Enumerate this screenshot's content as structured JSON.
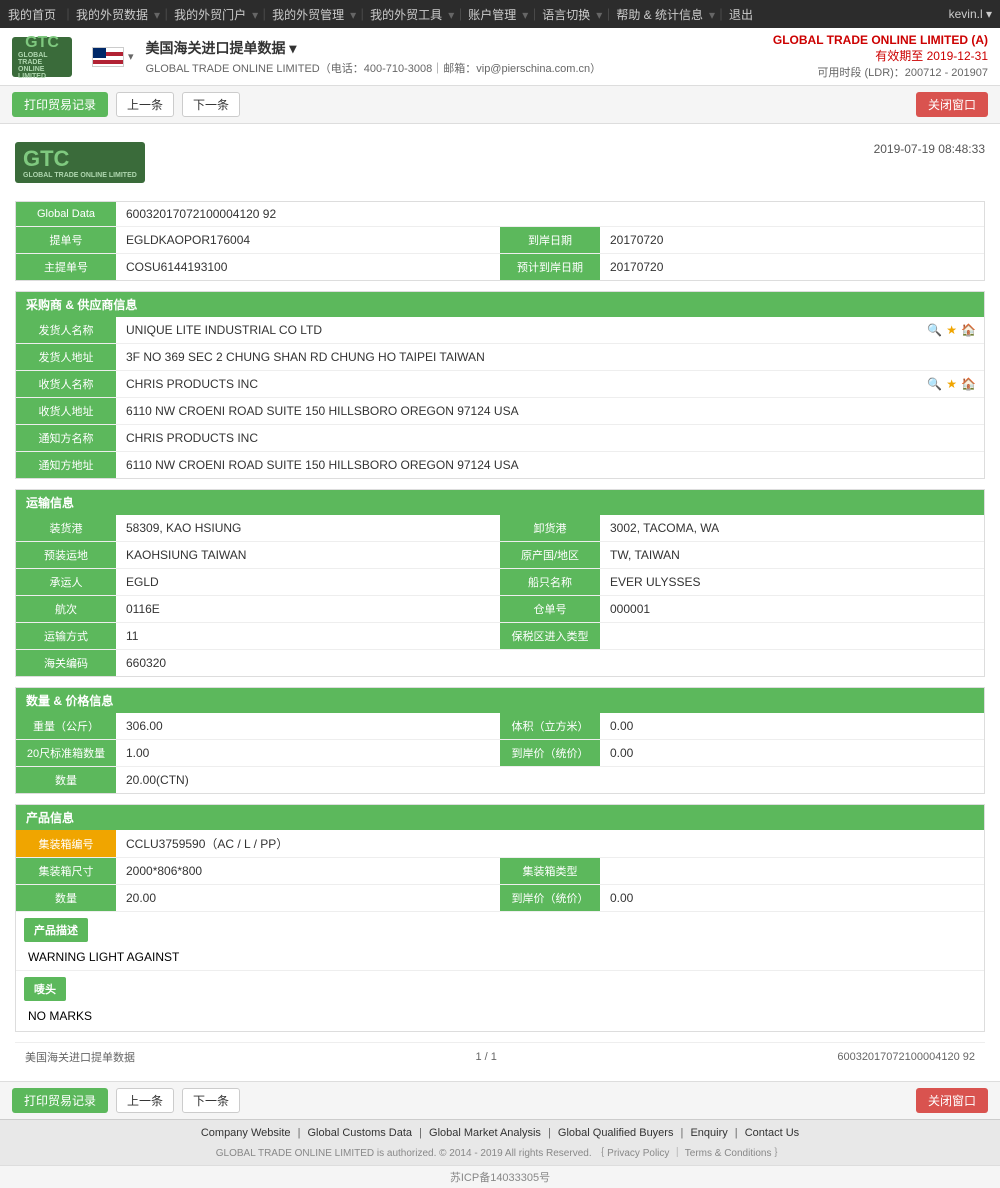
{
  "nav": {
    "items": [
      {
        "label": "我的首页",
        "hasArrow": false
      },
      {
        "label": "我的外贸数据",
        "hasArrow": true
      },
      {
        "label": "我的外贸门户",
        "hasArrow": true
      },
      {
        "label": "我的外贸管理",
        "hasArrow": true
      },
      {
        "label": "我的外贸工具",
        "hasArrow": true
      },
      {
        "label": "账户管理",
        "hasArrow": true
      },
      {
        "label": "语言切换",
        "hasArrow": true
      },
      {
        "label": "帮助 & 统计信息",
        "hasArrow": true
      },
      {
        "label": "退出",
        "hasArrow": false
      }
    ],
    "user": "kevin.l ▾"
  },
  "header": {
    "title": "美国海关进口提单数据 ▾",
    "subtitle": "GLOBAL TRADE ONLINE LIMITED（电话：400-710-3008｜邮箱：vip@pierschina.com.cn）",
    "brand": "GLOBAL TRADE ONLINE LIMITED (A)",
    "validity": "有效期至 2019-12-31",
    "period": "可用时段 (LDR)：200712 - 201907"
  },
  "toolbar": {
    "print_label": "打印贸易记录",
    "prev_label": "上一条",
    "next_label": "下一条",
    "close_label": "关闭窗口"
  },
  "doc": {
    "timestamp": "2019-07-19 08:48:33",
    "global_data_label": "Global Data",
    "global_data_value": "60032017072100004120 92",
    "fields": {
      "bill_no_label": "提单号",
      "bill_no_value": "EGLDKAOPOR176004",
      "arrival_date_label": "到岸日期",
      "arrival_date_value": "20170720",
      "master_bill_label": "主提单号",
      "master_bill_value": "COSU6144193100",
      "estimated_arrival_label": "预计到岸日期",
      "estimated_arrival_value": "20170720"
    }
  },
  "shipper_section": {
    "title": "采购商 & 供应商信息",
    "shipper_name_label": "发货人名称",
    "shipper_name_value": "UNIQUE LITE INDUSTRIAL CO LTD",
    "shipper_addr_label": "发货人地址",
    "shipper_addr_value": "3F NO 369 SEC 2 CHUNG SHAN RD CHUNG HO TAIPEI TAIWAN",
    "consignee_name_label": "收货人名称",
    "consignee_name_value": "CHRIS PRODUCTS INC",
    "consignee_addr_label": "收货人地址",
    "consignee_addr_value": "6110 NW CROENI ROAD SUITE 150 HILLSBORO OREGON 97124 USA",
    "notify_name_label": "通知方名称",
    "notify_name_value": "CHRIS PRODUCTS INC",
    "notify_addr_label": "通知方地址",
    "notify_addr_value": "6110 NW CROENI ROAD SUITE 150 HILLSBORO OREGON 97124 USA"
  },
  "transport_section": {
    "title": "运输信息",
    "loading_port_label": "装货港",
    "loading_port_value": "58309, KAO HSIUNG",
    "discharge_port_label": "卸货港",
    "discharge_port_value": "3002, TACOMA, WA",
    "preloading_label": "预装运地",
    "preloading_value": "KAOHSIUNG TAIWAN",
    "origin_label": "原产国/地区",
    "origin_value": "TW, TAIWAN",
    "carrier_label": "承运人",
    "carrier_value": "EGLD",
    "vessel_label": "船只名称",
    "vessel_value": "EVER ULYSSES",
    "voyage_label": "航次",
    "voyage_value": "0116E",
    "container_no_label": "仓单号",
    "container_no_value": "000001",
    "transport_mode_label": "运输方式",
    "transport_mode_value": "11",
    "bonded_label": "保税区进入类型",
    "bonded_value": "",
    "customs_label": "海关编码",
    "customs_value": "660320"
  },
  "quantity_section": {
    "title": "数量 & 价格信息",
    "weight_label": "重量（公斤）",
    "weight_value": "306.00",
    "volume_label": "体积（立方米）",
    "volume_value": "0.00",
    "container20_label": "20尺标准箱数量",
    "container20_value": "1.00",
    "dest_price_label": "到岸价（统价）",
    "dest_price_value": "0.00",
    "quantity_label": "数量",
    "quantity_value": "20.00(CTN)"
  },
  "product_section": {
    "title": "产品信息",
    "container_no_label": "集装箱编号",
    "container_no_value": "CCLU3759590（AC / L / PP）",
    "container_size_label": "集装箱尺寸",
    "container_size_value": "2000*806*800",
    "container_type_label": "集装箱类型",
    "container_type_value": "",
    "quantity_label": "数量",
    "quantity_value": "20.00",
    "dest_price_label": "到岸价（统价）",
    "dest_price_value": "0.00",
    "product_desc_label": "产品描述",
    "product_desc_value": "WARNING LIGHT AGAINST",
    "marks_label": "唛头",
    "marks_value": "NO MARKS"
  },
  "pagination": {
    "source": "美国海关进口提单数据",
    "page": "1 / 1",
    "record_id": "60032017072100004120 92"
  },
  "footer": {
    "links": [
      "Company Website",
      "Global Customs Data",
      "Global Market Analysis",
      "Global Qualified Buyers",
      "Enquiry",
      "Contact Us"
    ],
    "copyright": "GLOBAL TRADE ONLINE LIMITED is authorized. © 2014 - 2019 All rights Reserved.  ｛ Privacy Policy ｜ Terms & Conditions ｝",
    "icp": "苏ICP备14033305号"
  }
}
